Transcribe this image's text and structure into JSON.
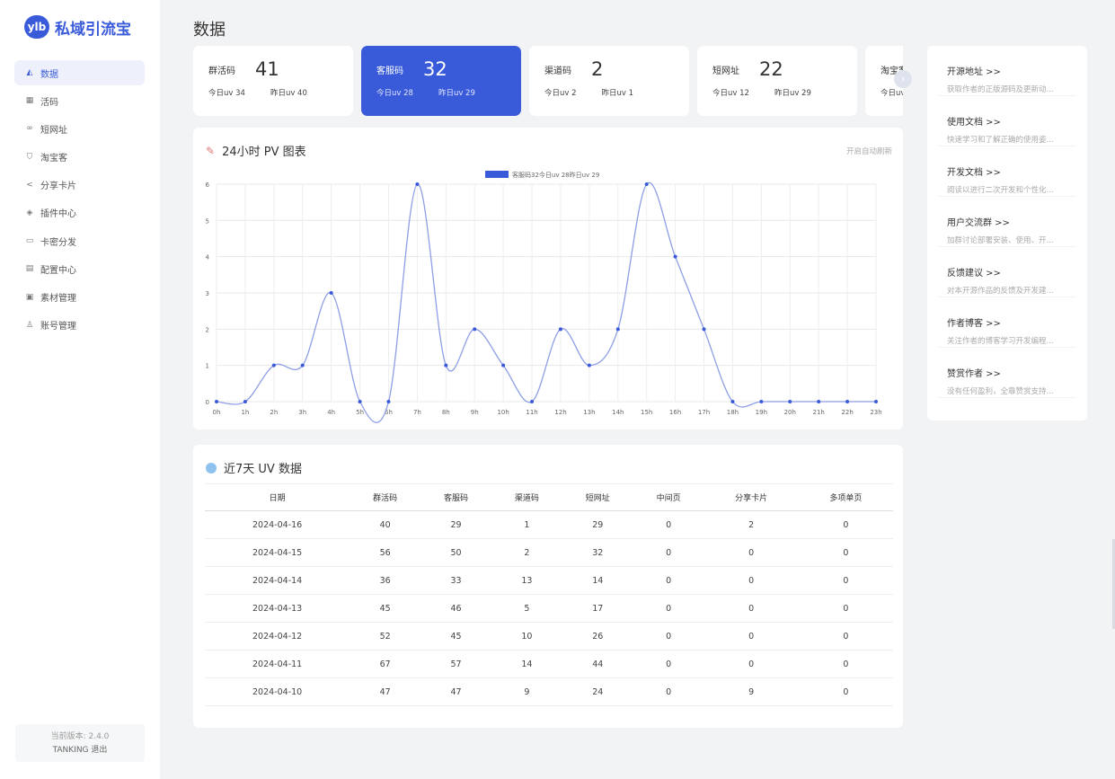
{
  "brand": {
    "badge": "ylb",
    "name": "私域引流宝"
  },
  "nav": [
    {
      "label": "数据",
      "icon": "chart-icon",
      "glyph": "◭"
    },
    {
      "label": "活码",
      "icon": "qrcode-icon",
      "glyph": "▦"
    },
    {
      "label": "短网址",
      "icon": "link-icon",
      "glyph": "∞"
    },
    {
      "label": "淘宝客",
      "icon": "cart-icon",
      "glyph": "⛉"
    },
    {
      "label": "分享卡片",
      "icon": "share-icon",
      "glyph": "<"
    },
    {
      "label": "插件中心",
      "icon": "plugin-icon",
      "glyph": "◈"
    },
    {
      "label": "卡密分发",
      "icon": "card-icon",
      "glyph": "▭"
    },
    {
      "label": "配置中心",
      "icon": "config-icon",
      "glyph": "▤"
    },
    {
      "label": "素材管理",
      "icon": "image-icon",
      "glyph": "▣"
    },
    {
      "label": "账号管理",
      "icon": "user-icon",
      "glyph": "♙"
    }
  ],
  "version": {
    "label": "当前版本: 2.4.0",
    "user": "TANKING",
    "logout": "退出"
  },
  "page_title": "数据",
  "cards": [
    {
      "label": "群活码",
      "value": "41",
      "today": "今日uv 34",
      "yesterday": "昨日uv 40"
    },
    {
      "label": "客服码",
      "value": "32",
      "today": "今日uv 28",
      "yesterday": "昨日uv 29"
    },
    {
      "label": "渠道码",
      "value": "2",
      "today": "今日uv 2",
      "yesterday": "昨日uv 1"
    },
    {
      "label": "短网址",
      "value": "22",
      "today": "今日uv 12",
      "yesterday": "昨日uv 29"
    },
    {
      "label": "淘宝客",
      "value": "",
      "today": "今日uv",
      "yesterday": ""
    }
  ],
  "chart_panel": {
    "title": "24小时 PV 图表",
    "auto_refresh": "开启自动刷新"
  },
  "chart_data": {
    "type": "line",
    "title": "24小时 PV 图表",
    "legend": "客服码32今日uv 28昨日uv 29",
    "legend_position": "top",
    "color": "#3a5bd9",
    "x": [
      "0h",
      "1h",
      "2h",
      "3h",
      "4h",
      "5h",
      "6h",
      "7h",
      "8h",
      "9h",
      "10h",
      "11h",
      "12h",
      "13h",
      "14h",
      "15h",
      "16h",
      "17h",
      "18h",
      "19h",
      "20h",
      "21h",
      "22h",
      "23h"
    ],
    "values": [
      0,
      0,
      1,
      1,
      3,
      0,
      0,
      6,
      1,
      2,
      1,
      0,
      2,
      1,
      2,
      6,
      4,
      2,
      0,
      0,
      0,
      0,
      0,
      0
    ],
    "yticks": [
      0,
      1,
      2,
      3,
      4,
      5,
      6
    ],
    "ylim": [
      0,
      6
    ],
    "grid": true
  },
  "uv_table": {
    "title": "近7天 UV 数据",
    "headers": [
      "日期",
      "群活码",
      "客服码",
      "渠道码",
      "短网址",
      "中间页",
      "分享卡片",
      "多项单页"
    ],
    "rows": [
      [
        "2024-04-16",
        "40",
        "29",
        "1",
        "29",
        "0",
        "2",
        "0"
      ],
      [
        "2024-04-15",
        "56",
        "50",
        "2",
        "32",
        "0",
        "0",
        "0"
      ],
      [
        "2024-04-14",
        "36",
        "33",
        "13",
        "14",
        "0",
        "0",
        "0"
      ],
      [
        "2024-04-13",
        "45",
        "46",
        "5",
        "17",
        "0",
        "0",
        "0"
      ],
      [
        "2024-04-12",
        "52",
        "45",
        "10",
        "26",
        "0",
        "0",
        "0"
      ],
      [
        "2024-04-11",
        "67",
        "57",
        "14",
        "44",
        "0",
        "0",
        "0"
      ],
      [
        "2024-04-10",
        "47",
        "47",
        "9",
        "24",
        "0",
        "9",
        "0"
      ]
    ]
  },
  "links": [
    {
      "title": "开源地址 >>",
      "desc": "获取作者的正版源码及更新动..."
    },
    {
      "title": "使用文档 >>",
      "desc": "快速学习和了解正确的使用姿..."
    },
    {
      "title": "开发文档 >>",
      "desc": "阅读以进行二次开发和个性化..."
    },
    {
      "title": "用户交流群 >>",
      "desc": "加群讨论部署安装、使用、开..."
    },
    {
      "title": "反馈建议 >>",
      "desc": "对本开源作品的反馈及开发建..."
    },
    {
      "title": "作者博客 >>",
      "desc": "关注作者的博客学习开发编程..."
    },
    {
      "title": "赞赏作者 >>",
      "desc": "没有任何盈利，全靠赞赏支持..."
    }
  ]
}
